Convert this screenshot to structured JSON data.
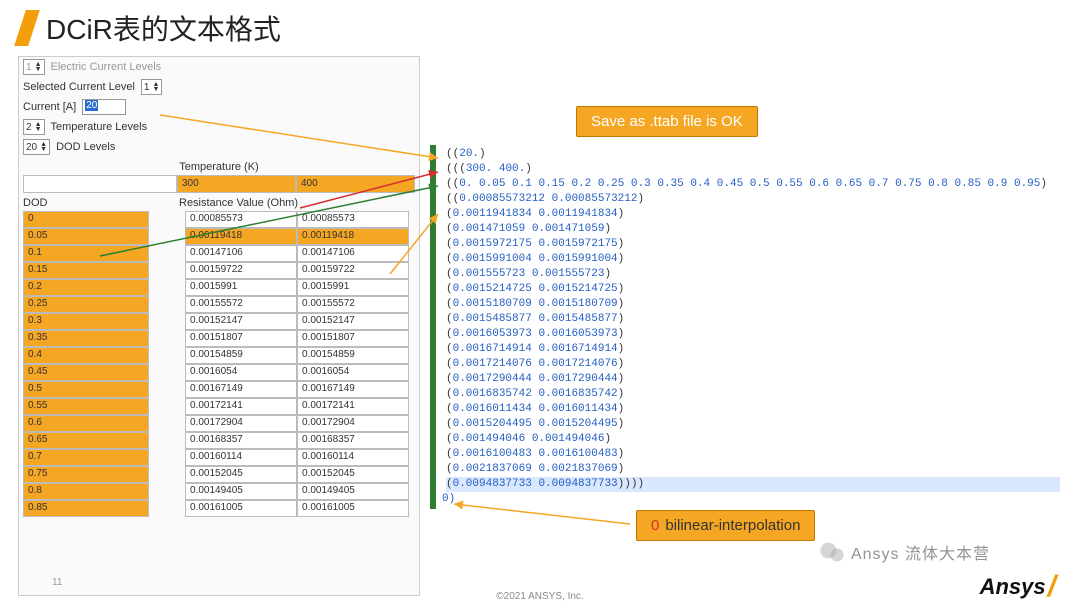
{
  "title": "DCiR表的文本格式",
  "controls": {
    "electric_levels_label": "Electric Current Levels",
    "electric_levels_value": "1",
    "selected_level_label": "Selected Current Level",
    "selected_level_value": "1",
    "current_label": "Current [A]",
    "current_value": "20",
    "temp_levels_value": "2",
    "temp_levels_label": "Temperature Levels",
    "dod_levels_value": "20",
    "dod_levels_label": "DOD Levels"
  },
  "headers": {
    "temp": "Temperature (K)",
    "dod": "DOD",
    "res": "Resistance Value (Ohm)"
  },
  "temps": [
    "300",
    "400"
  ],
  "rows": [
    {
      "d": "0",
      "a": "0.00085573",
      "b": "0.00085573"
    },
    {
      "d": "0.05",
      "a": "0.00119418",
      "b": "0.00119418",
      "hl": true
    },
    {
      "d": "0.1",
      "a": "0.00147106",
      "b": "0.00147106"
    },
    {
      "d": "0.15",
      "a": "0.00159722",
      "b": "0.00159722"
    },
    {
      "d": "0.2",
      "a": "0.0015991",
      "b": "0.0015991"
    },
    {
      "d": "0.25",
      "a": "0.00155572",
      "b": "0.00155572"
    },
    {
      "d": "0.3",
      "a": "0.00152147",
      "b": "0.00152147"
    },
    {
      "d": "0.35",
      "a": "0.00151807",
      "b": "0.00151807"
    },
    {
      "d": "0.4",
      "a": "0.00154859",
      "b": "0.00154859"
    },
    {
      "d": "0.45",
      "a": "0.0016054",
      "b": "0.0016054"
    },
    {
      "d": "0.5",
      "a": "0.00167149",
      "b": "0.00167149"
    },
    {
      "d": "0.55",
      "a": "0.00172141",
      "b": "0.00172141"
    },
    {
      "d": "0.6",
      "a": "0.00172904",
      "b": "0.00172904"
    },
    {
      "d": "0.65",
      "a": "0.00168357",
      "b": "0.00168357"
    },
    {
      "d": "0.7",
      "a": "0.00160114",
      "b": "0.00160114"
    },
    {
      "d": "0.75",
      "a": "0.00152045",
      "b": "0.00152045"
    },
    {
      "d": "0.8",
      "a": "0.00149405",
      "b": "0.00149405"
    },
    {
      "d": "0.85",
      "a": "0.00161005",
      "b": "0.00161005"
    }
  ],
  "code_lines": [
    "((20.)",
    "(((300. 400.)",
    "((0. 0.05 0.1 0.15 0.2 0.25 0.3 0.35 0.4 0.45 0.5 0.55 0.6 0.65 0.7 0.75 0.8 0.85 0.9 0.95)",
    "((0.00085573212 0.00085573212)",
    "(0.0011941834 0.0011941834)",
    "(0.001471059 0.001471059)",
    "(0.0015972175 0.0015972175)",
    "(0.0015991004 0.0015991004)",
    "(0.001555723 0.001555723)",
    "(0.0015214725 0.0015214725)",
    "(0.0015180709 0.0015180709)",
    "(0.0015485877 0.0015485877)",
    "(0.0016053973 0.0016053973)",
    "(0.0016714914 0.0016714914)",
    "(0.0017214076 0.0017214076)",
    "(0.0017290444 0.0017290444)",
    "(0.0016835742 0.0016835742)",
    "(0.0016011434 0.0016011434)",
    "(0.0015204495 0.0015204495)",
    "(0.001494046 0.001494046)",
    "(0.0016100483 0.0016100483)",
    "(0.0021837069 0.0021837069)",
    "(0.0094837733 0.0094837733))))"
  ],
  "code_tail": "0)",
  "annot_save": "Save as .ttab file is OK",
  "annot_bilinear_zero": "0",
  "annot_bilinear_text": "bilinear-interpolation",
  "footer": "©2021 ANSYS, Inc.",
  "brand": "Ansys",
  "watermark": "Ansys 流体大本营",
  "page_num": "11"
}
